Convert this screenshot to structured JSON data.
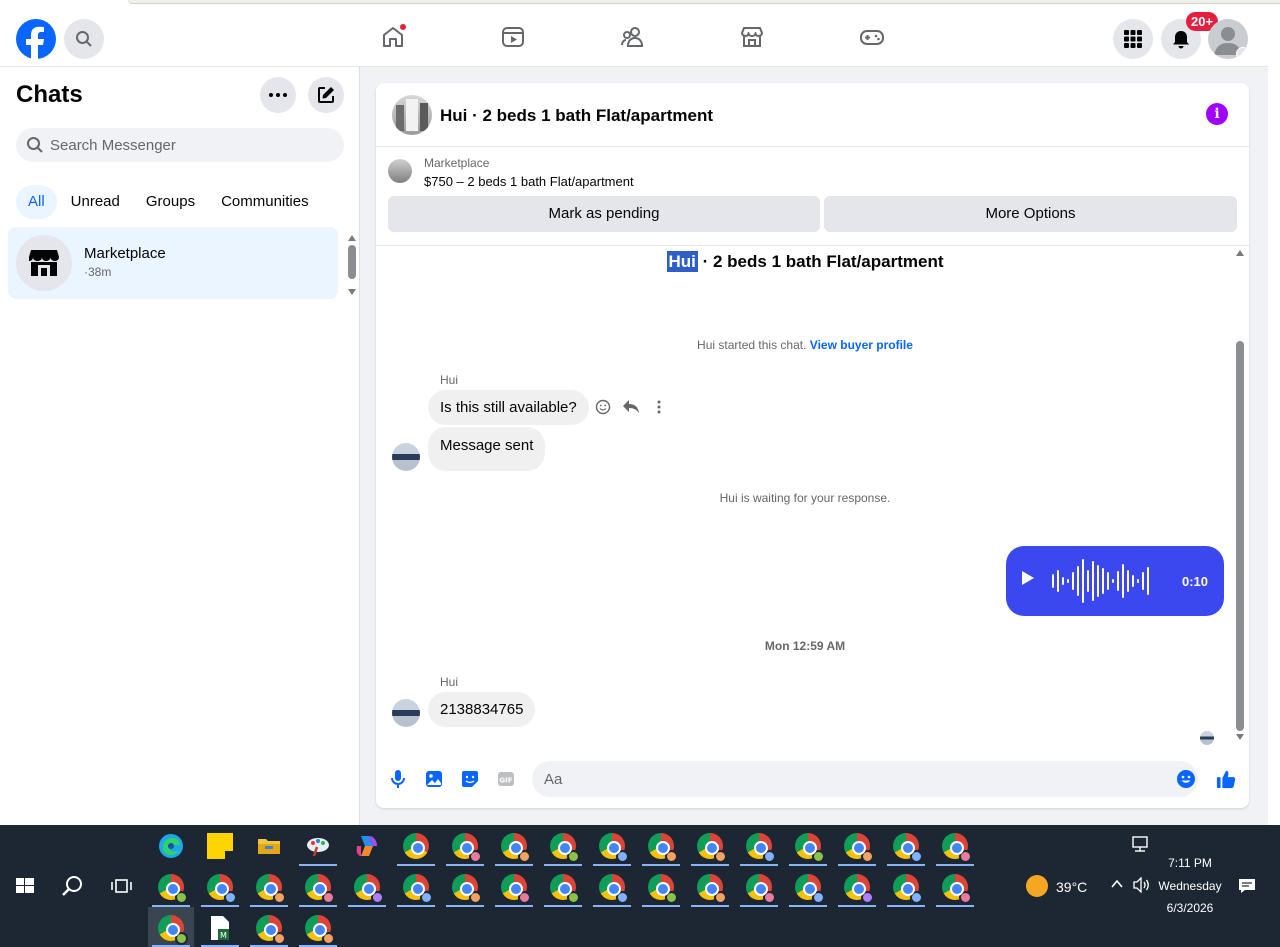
{
  "topnav": {
    "icons": [
      "facebook-logo",
      "search-icon",
      "home-icon",
      "video-icon",
      "friends-icon",
      "marketplace-icon",
      "gaming-icon",
      "menu-grid-icon",
      "bell-icon",
      "profile-avatar"
    ],
    "notification_badge": "20+"
  },
  "sidebar": {
    "title": "Chats",
    "search_placeholder": "Search Messenger",
    "filters": [
      "All",
      "Unread",
      "Groups",
      "Communities"
    ],
    "active_filter": "All",
    "chats": [
      {
        "name": "Marketplace",
        "time": "·38m"
      }
    ]
  },
  "conversation": {
    "header_title": "Hui · 2 beds 1 bath Flat/apartment",
    "listing": {
      "label": "Marketplace",
      "price_title": "$750 – 2 beds 1 bath Flat/apartment",
      "pending_button": "Mark as pending",
      "more_button": "More Options"
    },
    "title_name": "Hui",
    "title_rest": " · 2 beds 1 bath Flat/apartment",
    "started_text": "Hui started this chat.",
    "view_profile_link": "View buyer profile",
    "sender1": "Hui",
    "msg1": "Is this still available?",
    "msg2": "Message sent",
    "waiting_text": "Hui is waiting for your response.",
    "voice_duration": "0:10",
    "timestamp": "Mon 12:59 AM",
    "sender2": "Hui",
    "msg3": "2138834765",
    "composer_placeholder": "Aa"
  },
  "taskbar": {
    "weather": "39°C",
    "time": "7:11 PM",
    "day": "Wednesday",
    "date": "6/3/2026"
  },
  "colors": {
    "brand": "#0866ff",
    "voice_bubble": "#3b48f0",
    "badge": "#e41e3f",
    "info": "#a100ff"
  }
}
